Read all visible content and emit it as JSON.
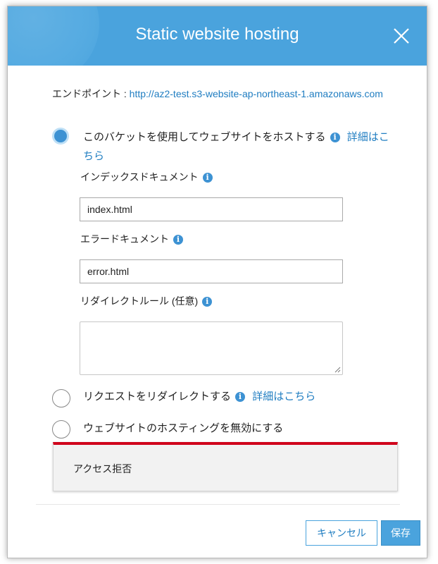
{
  "dialog": {
    "title": "Static website hosting"
  },
  "endpoint": {
    "label": "エンドポイント : ",
    "url": "http://az2-test.s3-website-ap-northeast-1.amazonaws.com"
  },
  "options": {
    "host": {
      "label": "このバケットを使用してウェブサイトをホストする",
      "details_link": "詳細はこちら",
      "selected": true
    },
    "redirect": {
      "label": "リクエストをリダイレクトする",
      "details_link": "詳細はこちら",
      "selected": false
    },
    "disable": {
      "label": "ウェブサイトのホスティングを無効にする",
      "selected": false
    }
  },
  "fields": {
    "index_label": "インデックスドキュメント",
    "index_value": "index.html",
    "error_label": "エラードキュメント",
    "error_value": "error.html",
    "redirect_rules_label": "リダイレクトルール (任意)",
    "redirect_rules_value": ""
  },
  "alert": {
    "message": "アクセス拒否",
    "accent_color": "#d0021b"
  },
  "buttons": {
    "cancel": "キャンセル",
    "save": "保存"
  },
  "theme": {
    "header_color": "#4aa3dd",
    "link_color": "#1f7dc1"
  },
  "icons": [
    "close-icon",
    "info-icon",
    "radio-selected-icon",
    "radio-unselected-icon",
    "resize-grip-icon"
  ]
}
